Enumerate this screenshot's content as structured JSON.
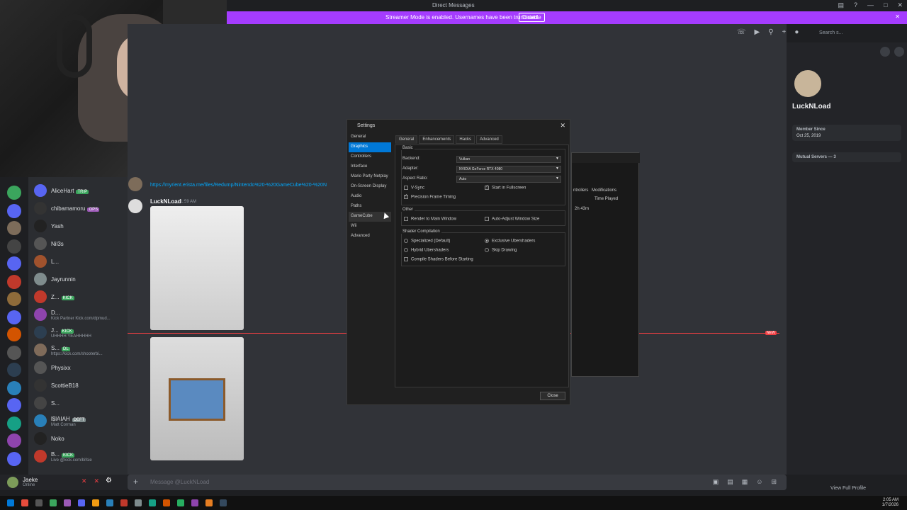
{
  "window": {
    "title": "Direct Messages"
  },
  "banner": {
    "message": "Streamer Mode is enabled. Usernames have been truncated.",
    "disable_label": "Disable"
  },
  "search": {
    "placeholder": "Search s..."
  },
  "dm_list": [
    {
      "name": "AliceHart",
      "tag": "TRIP",
      "status": ""
    },
    {
      "name": "chibamamoru",
      "tag": "OPS",
      "status": ""
    },
    {
      "name": "Yash",
      "tag": "",
      "status": ""
    },
    {
      "name": "Nil3s",
      "tag": "",
      "status": ""
    },
    {
      "name": "L...",
      "tag": "",
      "status": ""
    },
    {
      "name": "Jayrunnin",
      "tag": "",
      "status": ""
    },
    {
      "name": "Z...",
      "tag": "KICK",
      "status": ""
    },
    {
      "name": "D...",
      "tag": "",
      "status": "Kick Partner Kick.com/dpmud..."
    },
    {
      "name": "J...",
      "tag": "KICK",
      "status": "UHHHH YEAHHHHH"
    },
    {
      "name": "S...",
      "tag": "DL",
      "status": "https://kick.com/shooterbi..."
    },
    {
      "name": "Physixx",
      "tag": "",
      "status": ""
    },
    {
      "name": "ScottieB18",
      "tag": "",
      "status": ""
    },
    {
      "name": "S...",
      "tag": "",
      "status": ""
    },
    {
      "name": "l$lAIAH",
      "tag": "DEFT",
      "status": "Matt Corman"
    },
    {
      "name": "Noko",
      "tag": "",
      "status": ""
    },
    {
      "name": "B...",
      "tag": "KICK",
      "status": "Live @kick.com/bifsie"
    }
  ],
  "messages": {
    "first_link": "https://myrient.erista.me/files/Redump/Nintendo%20-%20GameCube%20-%20N",
    "author": "LuckNLoad",
    "time": "1:59 AM"
  },
  "new_badge": "NEW",
  "composer": {
    "placeholder": "Message @LuckNLoad"
  },
  "user": {
    "name": "Jaeke",
    "status": "Online"
  },
  "profile": {
    "name": "LuckNLoad",
    "member_since_label": "Member Since",
    "member_since": "Oct 25, 2019",
    "mutual_servers": "Mutual Servers — 3",
    "view_full": "View Full Profile"
  },
  "gamelist": {
    "controllers": "ntrollers",
    "modifications": "Modifications",
    "time_played_label": "Time Played",
    "time_value": "2h 43m"
  },
  "settings": {
    "title": "Settings",
    "nav": [
      "General",
      "Graphics",
      "Controllers",
      "Interface",
      "Mario Party Netplay",
      "On-Screen Display",
      "Audio",
      "Paths",
      "GameCube",
      "Wii",
      "Advanced"
    ],
    "selected_nav": 1,
    "tabs": [
      "General",
      "Enhancements",
      "Hacks",
      "Advanced"
    ],
    "basic_label": "Basic",
    "backend_label": "Backend:",
    "backend_value": "Vulkan",
    "adapter_label": "Adapter:",
    "adapter_value": "NVIDIA GeForce RTX 4080",
    "aspect_label": "Aspect Ratio:",
    "aspect_value": "Auto",
    "vsync_label": "V-Sync",
    "fullscreen_label": "Start in Fullscreen",
    "precision_label": "Precision Frame Timing",
    "other_label": "Other",
    "render_main_label": "Render to Main Window",
    "auto_adjust_label": "Auto-Adjust Window Size",
    "shader_label": "Shader Compilation",
    "specialized_label": "Specialized (Default)",
    "exclusive_label": "Exclusive Ubershaders",
    "hybrid_label": "Hybrid Ubershaders",
    "skip_label": "Skip Drawing",
    "compile_label": "Compile Shaders Before Starting",
    "close_label": "Close"
  },
  "clock": {
    "time": "2:05 AM",
    "date": "1/7/2026"
  }
}
